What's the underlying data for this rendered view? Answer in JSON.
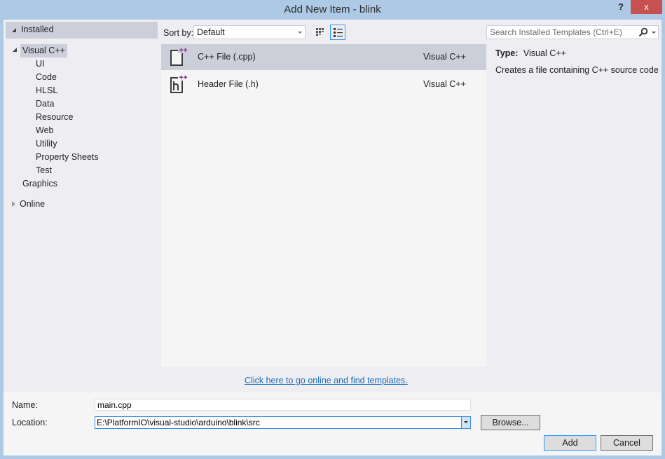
{
  "window": {
    "title": "Add New Item - blink",
    "help_label": "?",
    "close_label": "x"
  },
  "tree": {
    "installed_label": "Installed",
    "visual_cpp_label": "Visual C++",
    "children": [
      "UI",
      "Code",
      "HLSL",
      "Data",
      "Resource",
      "Web",
      "Utility",
      "Property Sheets",
      "Test"
    ],
    "graphics_label": "Graphics",
    "online_label": "Online"
  },
  "sort": {
    "label": "Sort by:",
    "value": "Default"
  },
  "templates": [
    {
      "name": "C++ File (.cpp)",
      "language": "Visual C++",
      "icon": "cpp-file-icon",
      "selected": true
    },
    {
      "name": "Header File (.h)",
      "language": "Visual C++",
      "icon": "header-file-icon",
      "selected": false
    }
  ],
  "search": {
    "placeholder": "Search Installed Templates (Ctrl+E)"
  },
  "details": {
    "type_label": "Type:",
    "type_value": "Visual C++",
    "description": "Creates a file containing C++ source code"
  },
  "online_link": "Click here to go online and find templates.",
  "form": {
    "name_label": "Name:",
    "name_value": "main.cpp",
    "location_label": "Location:",
    "location_value": "E:\\PlatformIO\\visual-studio\\arduino\\blink\\src",
    "browse_label": "Browse...",
    "add_label": "Add",
    "cancel_label": "Cancel"
  },
  "colors": {
    "accent": "#3399ff",
    "selection": "#ccced9",
    "close": "#c75050",
    "link": "#1e6bb8",
    "plus_purple": "#8e3a8e"
  }
}
